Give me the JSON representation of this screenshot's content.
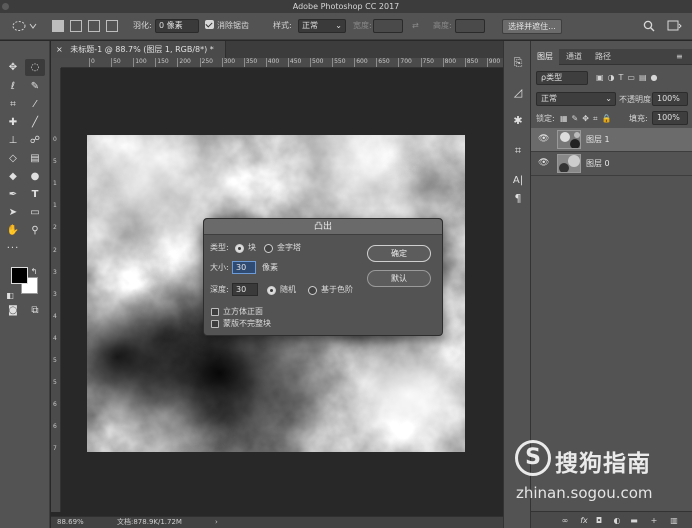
{
  "app": {
    "title": "Adobe Photoshop CC 2017"
  },
  "options_bar": {
    "feather_label": "羽化:",
    "feather_value": "0 像素",
    "antialias_label": "消除锯齿",
    "style_label": "样式:",
    "style_value": "正常",
    "width_label": "宽度:",
    "height_label": "高度:",
    "select_mask_button": "选择并遮住..."
  },
  "document": {
    "tab_label": "未标题-1 @ 88.7% (图层 1, RGB/8*) *",
    "close_glyph": "×"
  },
  "ruler": {
    "h_ticks": [
      "0",
      "50",
      "100",
      "150",
      "200",
      "250",
      "300",
      "350",
      "400",
      "450",
      "500",
      "550",
      "600",
      "650",
      "700",
      "750",
      "800",
      "850",
      "900",
      "950"
    ],
    "v_ticks": [
      "0",
      "5",
      "1",
      "1",
      "2",
      "2",
      "3",
      "3",
      "4",
      "4",
      "5",
      "5",
      "6",
      "6",
      "7"
    ]
  },
  "status_bar": {
    "zoom": "88.69%",
    "doc_info": "文档:878.9K/1.72M",
    "arrow": "›"
  },
  "dialog": {
    "title": "凸出",
    "type_label": "类型:",
    "type_options": [
      "块",
      "金字塔"
    ],
    "size_label": "大小:",
    "size_value": "30",
    "size_unit": "像素",
    "depth_label": "深度:",
    "depth_value": "30",
    "depth_options": [
      "随机",
      "基于色阶"
    ],
    "checkbox_front_faces": "立方体正面",
    "checkbox_mask_incomplete": "蒙版不完整块",
    "ok_button": "确定",
    "default_button": "默认"
  },
  "layers_panel": {
    "tabs": [
      "图层",
      "通道",
      "路径"
    ],
    "filter_label": "ρ类型",
    "blend_mode": "正常",
    "opacity_label": "不透明度:",
    "opacity_value": "100%",
    "lock_label": "锁定:",
    "fill_label": "填充:",
    "fill_value": "100%",
    "layers": [
      {
        "name": "图层 1",
        "selected": true
      },
      {
        "name": "图层 0",
        "selected": false
      }
    ],
    "bottom_icons": [
      "link-icon",
      "fx-icon",
      "mask-icon",
      "adjustment-icon",
      "folder-icon",
      "new-layer-icon",
      "trash-icon"
    ],
    "bottom_labels": [
      "∞",
      "fx",
      "◘",
      "◐",
      "▬",
      "+",
      "▥"
    ]
  },
  "watermark": {
    "logo": "S",
    "text": "搜狗指南",
    "url": "zhinan.sogou.com"
  },
  "colors": {
    "ui_dark": "#282828",
    "panel": "#535353",
    "selected_layer": "#6b6b6b",
    "focus_input": "#2f4b72"
  }
}
